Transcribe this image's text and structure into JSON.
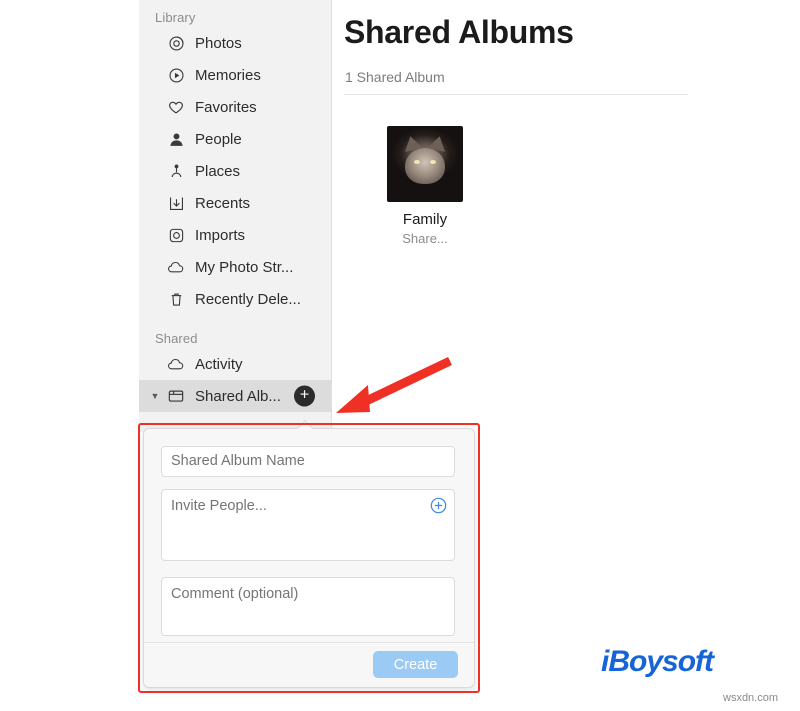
{
  "sidebar": {
    "sections": [
      {
        "title": "Library",
        "items": [
          {
            "label": "Photos",
            "icon": "photos-icon"
          },
          {
            "label": "Memories",
            "icon": "memories-icon"
          },
          {
            "label": "Favorites",
            "icon": "heart-icon"
          },
          {
            "label": "People",
            "icon": "person-icon"
          },
          {
            "label": "Places",
            "icon": "pin-icon"
          },
          {
            "label": "Recents",
            "icon": "download-arrow-icon"
          },
          {
            "label": "Imports",
            "icon": "imports-icon"
          },
          {
            "label": "My Photo Str...",
            "icon": "cloud-icon"
          },
          {
            "label": "Recently Dele...",
            "icon": "trash-icon"
          }
        ]
      },
      {
        "title": "Shared",
        "items": [
          {
            "label": "Activity",
            "icon": "cloud-icon"
          },
          {
            "label": "Shared Alb...",
            "icon": "shared-album-icon",
            "disclosure": "▼",
            "badge": "+"
          }
        ]
      }
    ]
  },
  "main": {
    "title": "Shared Albums",
    "subtitle": "1 Shared Album",
    "album": {
      "name": "Family",
      "status": "Share..."
    }
  },
  "popover": {
    "name_placeholder": "Shared Album Name",
    "name_value": "",
    "invite_placeholder": "Invite People...",
    "invite_value": "",
    "comment_placeholder": "Comment (optional)",
    "comment_value": "",
    "add_person_icon": "plus-circle-icon",
    "create_label": "Create"
  },
  "annotation": {
    "arrow_color": "#ee3124",
    "box_color": "#ee3124"
  },
  "watermark": {
    "prefix": "i",
    "brand": "Boysoft",
    "site": "wsxdn.com"
  }
}
